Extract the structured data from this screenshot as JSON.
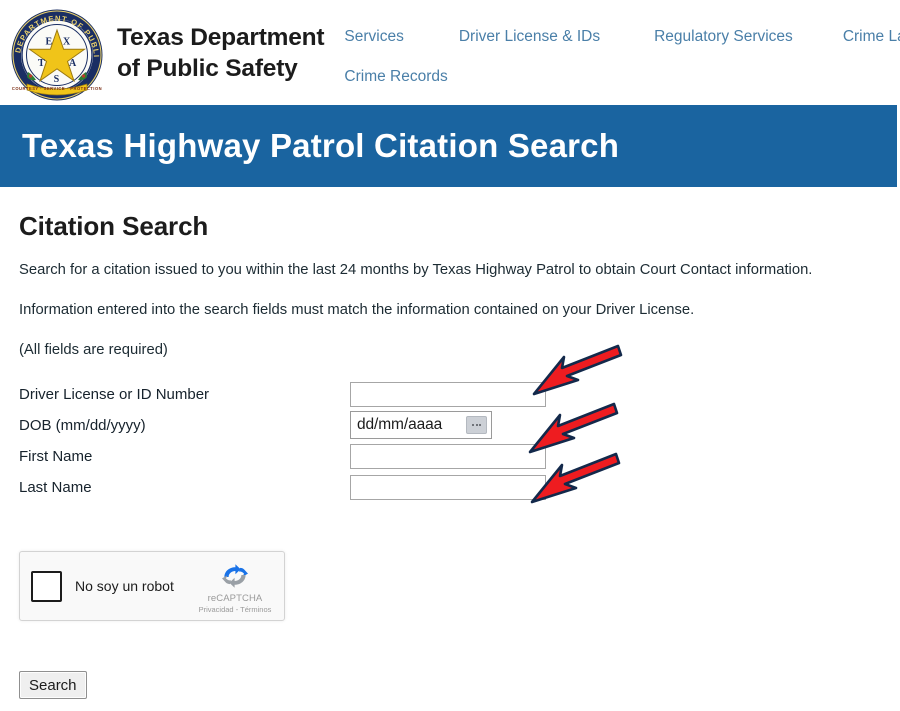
{
  "header": {
    "logo_alt": "Texas Department of Public Safety seal",
    "seal_text_top": "DEPARTMENT OF PUBLIC SAFETY",
    "seal_letters": [
      "E",
      "X",
      "T",
      "A",
      "S"
    ],
    "brand_title": "Texas Department\nof Public Safety",
    "nav": {
      "row1": [
        {
          "label": "Services",
          "name": "nav-link-services"
        },
        {
          "label": "Driver License & IDs",
          "name": "nav-link-driver-license-ids"
        },
        {
          "label": "Regulatory Services",
          "name": "nav-link-regulatory-services"
        },
        {
          "label": "Crime Laboratory",
          "name": "nav-link-crime-laboratory"
        }
      ],
      "row2": [
        {
          "label": "Crime Records",
          "name": "nav-link-crime-records"
        }
      ]
    }
  },
  "banner": {
    "title": "Texas Highway Patrol Citation Search",
    "background_color": "#1a64a0",
    "text_color": "#ffffff"
  },
  "main": {
    "section_title": "Citation Search",
    "paragraph_1": "Search for a citation issued to you within the last 24 months by Texas Highway Patrol to obtain Court Contact information.",
    "paragraph_2": "Information entered into the search fields must match the information contained on your Driver License.",
    "paragraph_3": "(All fields are required)"
  },
  "form": {
    "fields": [
      {
        "label": "Driver License or ID Number",
        "name": "driver-license-or-id-number",
        "type": "text",
        "value": "",
        "placeholder": ""
      },
      {
        "label": "DOB (mm/dd/yyyy)",
        "name": "dob",
        "type": "date",
        "value": "",
        "placeholder": "dd/mm/aaaa"
      },
      {
        "label": "First Name",
        "name": "first-name",
        "type": "text",
        "value": "",
        "placeholder": ""
      },
      {
        "label": "Last Name",
        "name": "last-name",
        "type": "text",
        "value": "",
        "placeholder": ""
      }
    ],
    "submit_label": "Search"
  },
  "recaptcha": {
    "checkbox_label": "No soy un robot",
    "brand_name": "reCAPTCHA",
    "privacy_label": "Privacidad",
    "separator": " - ",
    "terms_label": "Términos"
  },
  "annotations": {
    "arrow_color": "#ee1c20",
    "arrow_outline_color": "#13294b",
    "arrows": [
      {
        "name": "arrow-pointing-to-driver-license-field"
      },
      {
        "name": "arrow-pointing-to-dob-field"
      },
      {
        "name": "arrow-pointing-to-last-name-field"
      }
    ]
  }
}
